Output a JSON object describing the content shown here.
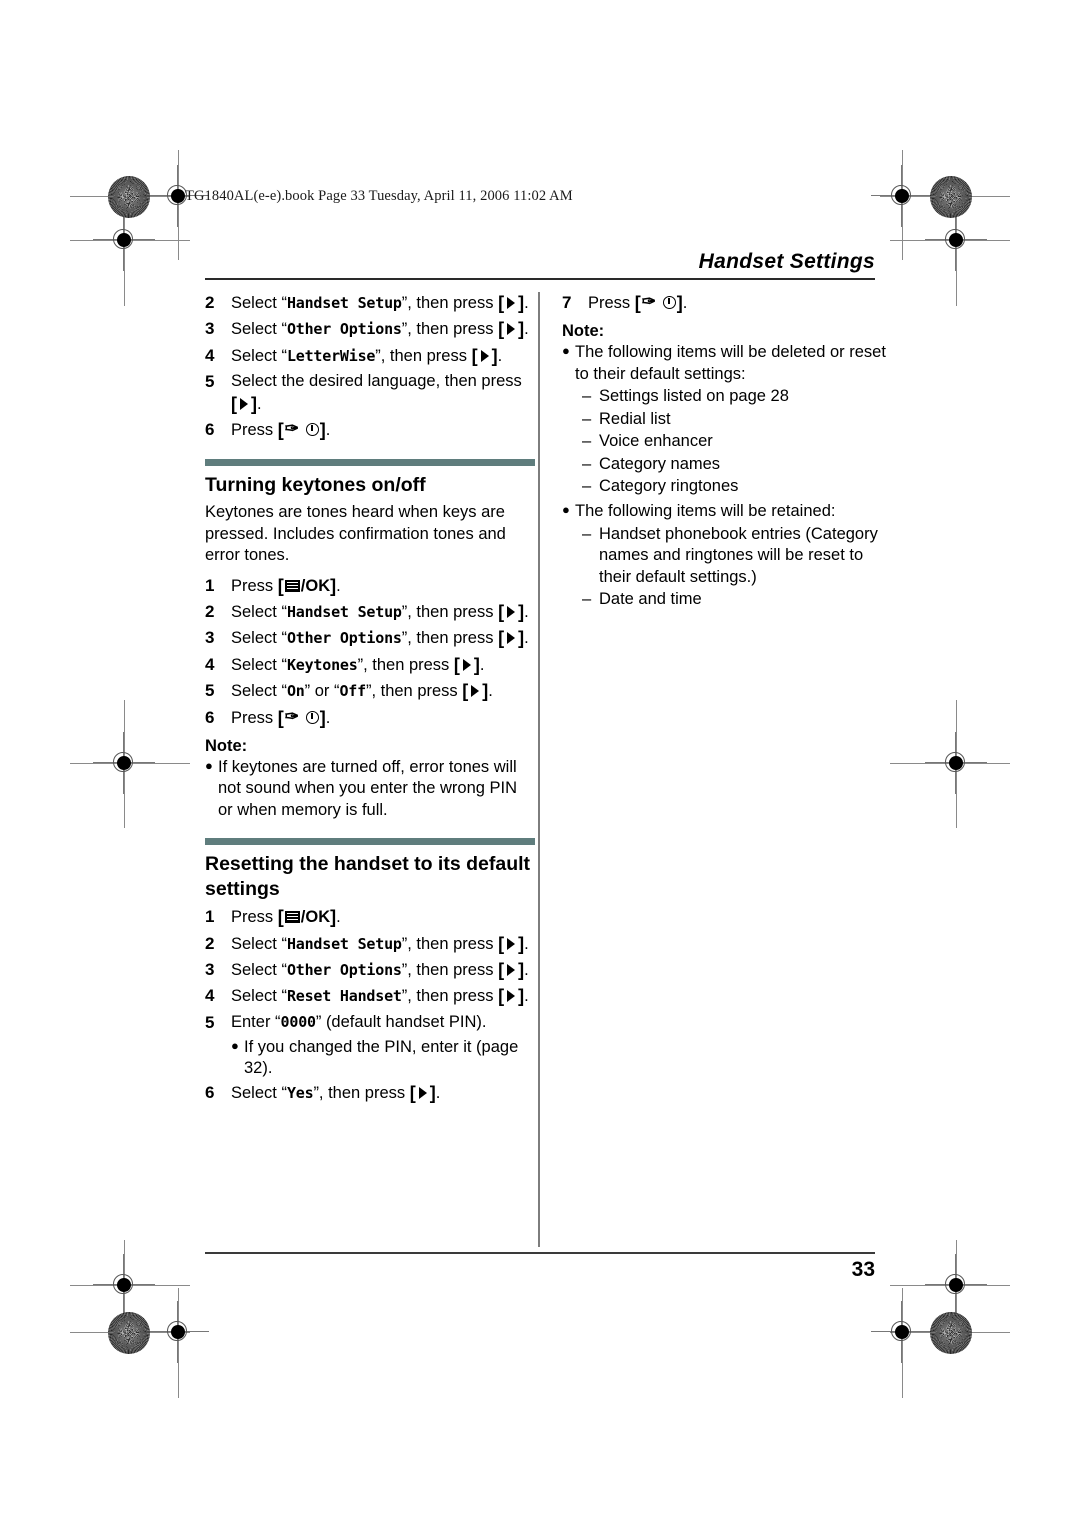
{
  "file_header": "TG1840AL(e-e).book  Page 33  Tuesday, April 11, 2006  11:02 AM",
  "running_head": "Handset Settings",
  "page_number": "33",
  "glyphs": {
    "right_key": "[▶]",
    "menu_ok_key": "[▤/OK]",
    "off_key": "[✁⓪]",
    "ok_label": "/OK",
    "bullet": "●",
    "dash": "–",
    "bracket_open": "[",
    "bracket_close": "]"
  },
  "colors": {
    "section_bar": "#5f7d7d",
    "divider": "#7d7d7d",
    "rule": "#2a2a2a"
  },
  "left_column": {
    "letterwise_steps": [
      {
        "num": "2",
        "pre": "Select “",
        "mono": "Handset Setup",
        "post": "”, then press",
        "key": "right",
        "tail": "."
      },
      {
        "num": "3",
        "pre": "Select “",
        "mono": "Other Options",
        "post": "”, then press",
        "key": "right",
        "tail": "."
      },
      {
        "num": "4",
        "pre": "Select “",
        "mono": "LetterWise",
        "post": "”, then press",
        "key": "right",
        "tail": "."
      },
      {
        "num": "5",
        "pre": "Select the desired language, then press",
        "mono": "",
        "post": "",
        "key": "right",
        "tail": "."
      },
      {
        "num": "6",
        "pre": "Press",
        "mono": "",
        "post": "",
        "key": "off",
        "tail": "."
      }
    ],
    "keytones_section": {
      "title": "Turning keytones on/off",
      "paragraph": "Keytones are tones heard when keys are pressed. Includes confirmation tones and error tones.",
      "steps": [
        {
          "num": "1",
          "pre": "Press",
          "mono": "",
          "post": "",
          "key": "menu",
          "tail": "."
        },
        {
          "num": "2",
          "pre": "Select “",
          "mono": "Handset Setup",
          "post": "”, then press",
          "key": "right",
          "tail": "."
        },
        {
          "num": "3",
          "pre": "Select “",
          "mono": "Other Options",
          "post": "”, then press",
          "key": "right",
          "tail": "."
        },
        {
          "num": "4",
          "pre": "Select “",
          "mono": "Keytones",
          "post": "”, then press",
          "key": "right",
          "tail": "."
        },
        {
          "num": "5",
          "pre": "Select “",
          "mono": "On",
          "post": "” or “",
          "mono2": "Off",
          "post2": "”, then press",
          "key": "right",
          "tail": "."
        },
        {
          "num": "6",
          "pre": "Press",
          "mono": "",
          "post": "",
          "key": "off",
          "tail": "."
        }
      ],
      "note_label": "Note:",
      "note_items": [
        "If keytones are turned off, error tones will not sound when you enter the wrong PIN or when memory is full."
      ]
    },
    "reset_section": {
      "title": "Resetting the handset to its default settings",
      "steps": [
        {
          "num": "1",
          "pre": "Press",
          "mono": "",
          "post": "",
          "key": "menu",
          "tail": "."
        },
        {
          "num": "2",
          "pre": "Select “",
          "mono": "Handset Setup",
          "post": "”, then press",
          "key": "right",
          "tail": "."
        },
        {
          "num": "3",
          "pre": "Select “",
          "mono": "Other Options",
          "post": "”, then press",
          "key": "right",
          "tail": "."
        },
        {
          "num": "4",
          "pre": "Select “",
          "mono": "Reset Handset",
          "post": "”, then press",
          "key": "right",
          "tail": "."
        },
        {
          "num": "5",
          "pre": "Enter “",
          "mono": "0000",
          "post": "” (default handset PIN).",
          "key": "none",
          "tail": ""
        },
        {
          "num": "6",
          "pre": "Select “",
          "mono": "Yes",
          "post": "”, then press",
          "key": "right",
          "tail": "."
        }
      ],
      "step5_note": "If you changed the PIN, enter it (page 32)."
    }
  },
  "right_column": {
    "step7": {
      "num": "7",
      "pre": "Press",
      "key": "off",
      "tail": "."
    },
    "note_label": "Note:",
    "deleted_intro": "The following items will be deleted or reset to their default settings:",
    "deleted_items": [
      "Settings listed on page 28",
      "Redial list",
      "Voice enhancer",
      "Category names",
      "Category ringtones"
    ],
    "retained_intro": "The following items will be retained:",
    "retained_items": [
      "Handset phonebook entries (Category names and ringtones will be reset to their default settings.)",
      "Date and time"
    ]
  }
}
